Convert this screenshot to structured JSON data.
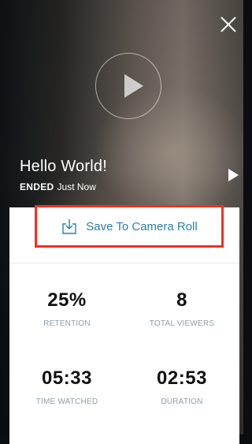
{
  "broadcast": {
    "title": "Hello World!",
    "status_label": "ENDED",
    "status_time": "Just Now"
  },
  "actions": {
    "save_label": "Save To Camera Roll"
  },
  "stats": {
    "retention": {
      "value": "25%",
      "label": "RETENTION"
    },
    "total_viewers": {
      "value": "8",
      "label": "TOTAL VIEWERS"
    },
    "time_watched": {
      "value": "05:33",
      "label": "TIME WATCHED"
    },
    "duration": {
      "value": "02:53",
      "label": "DURATION"
    }
  },
  "icons": {
    "close": "close-icon",
    "play": "play-icon",
    "next": "play-next-icon",
    "download": "download-icon"
  },
  "colors": {
    "accent": "#2a7fa9",
    "highlight_border": "#f0311f",
    "stat_label": "#8f9ca6"
  }
}
